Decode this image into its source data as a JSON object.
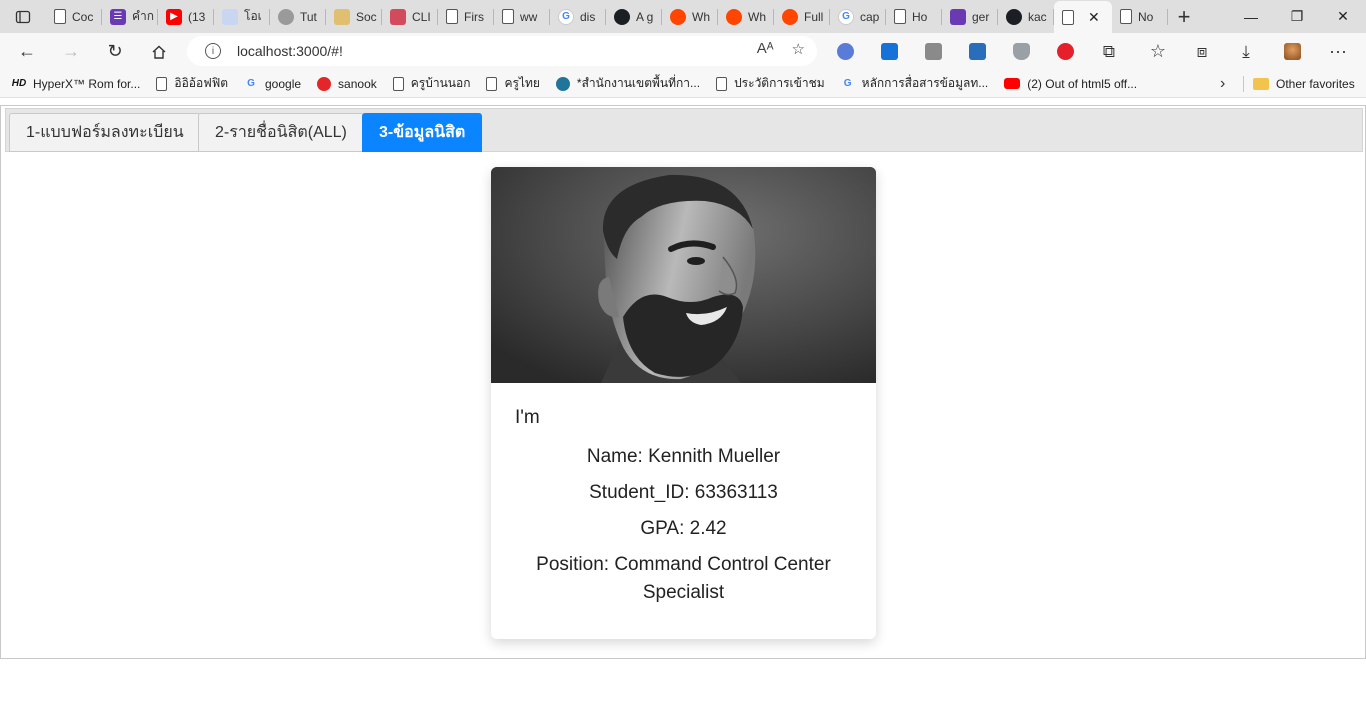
{
  "browser": {
    "tabs": [
      {
        "label": "Coc",
        "icon": "doc-icon"
      },
      {
        "label": "คำก",
        "icon": "forms-icon"
      },
      {
        "label": "(13",
        "icon": "youtube-icon"
      },
      {
        "label": "โอเ",
        "icon": "calendar-icon"
      },
      {
        "label": "Tut",
        "icon": "site-icon"
      },
      {
        "label": "Soc",
        "icon": "site-icon"
      },
      {
        "label": "CLI",
        "icon": "site-icon"
      },
      {
        "label": "Firs",
        "icon": "doc-icon"
      },
      {
        "label": "ww",
        "icon": "doc-icon"
      },
      {
        "label": "dis",
        "icon": "google-icon"
      },
      {
        "label": "A g",
        "icon": "github-icon"
      },
      {
        "label": "Wh",
        "icon": "reddit-icon"
      },
      {
        "label": "Wh",
        "icon": "reddit-icon"
      },
      {
        "label": "Full",
        "icon": "reddit-icon"
      },
      {
        "label": "cap",
        "icon": "google-icon"
      },
      {
        "label": "Ho",
        "icon": "doc-icon"
      },
      {
        "label": "ger",
        "icon": "site-icon"
      },
      {
        "label": "kac",
        "icon": "github-icon"
      },
      {
        "label": "",
        "icon": "doc-icon",
        "active": true
      },
      {
        "label": "No",
        "icon": "doc-icon"
      }
    ],
    "url": "localhost:3000/#!",
    "bookmarks": [
      {
        "label": "HyperX™ Rom for...",
        "icon": "hd-icon"
      },
      {
        "label": "อิอิอ้อฟฟิต",
        "icon": "doc-icon"
      },
      {
        "label": "google",
        "icon": "google-icon"
      },
      {
        "label": "sanook",
        "icon": "sanook-icon"
      },
      {
        "label": "ครูบ้านนอก",
        "icon": "doc-icon"
      },
      {
        "label": "ครูไทย",
        "icon": "doc-icon"
      },
      {
        "label": "*สำนักงานเขตพื้นที่กา...",
        "icon": "wordpress-icon"
      },
      {
        "label": "ประวัติการเข้าชม",
        "icon": "doc-icon"
      },
      {
        "label": "หลักการสื่อสารข้อมูลท...",
        "icon": "google-icon"
      },
      {
        "label": "(2) Out of html5 off...",
        "icon": "youtube-icon"
      }
    ],
    "other_favorites": "Other favorites"
  },
  "app": {
    "tabs": [
      {
        "label": "1-แบบฟอร์มลงทะเบียน"
      },
      {
        "label": "2-รายชื่อนิสิต(ALL)"
      },
      {
        "label": "3-ข้อมูลนิสิต",
        "active": true
      }
    ],
    "profile": {
      "intro": "I'm",
      "name_line": "Name: Kennith Mueller",
      "id_line": "Student_ID: 63363113",
      "gpa_line": "GPA: 2.42",
      "position_line": "Position: Command Control Center Specialist"
    }
  }
}
